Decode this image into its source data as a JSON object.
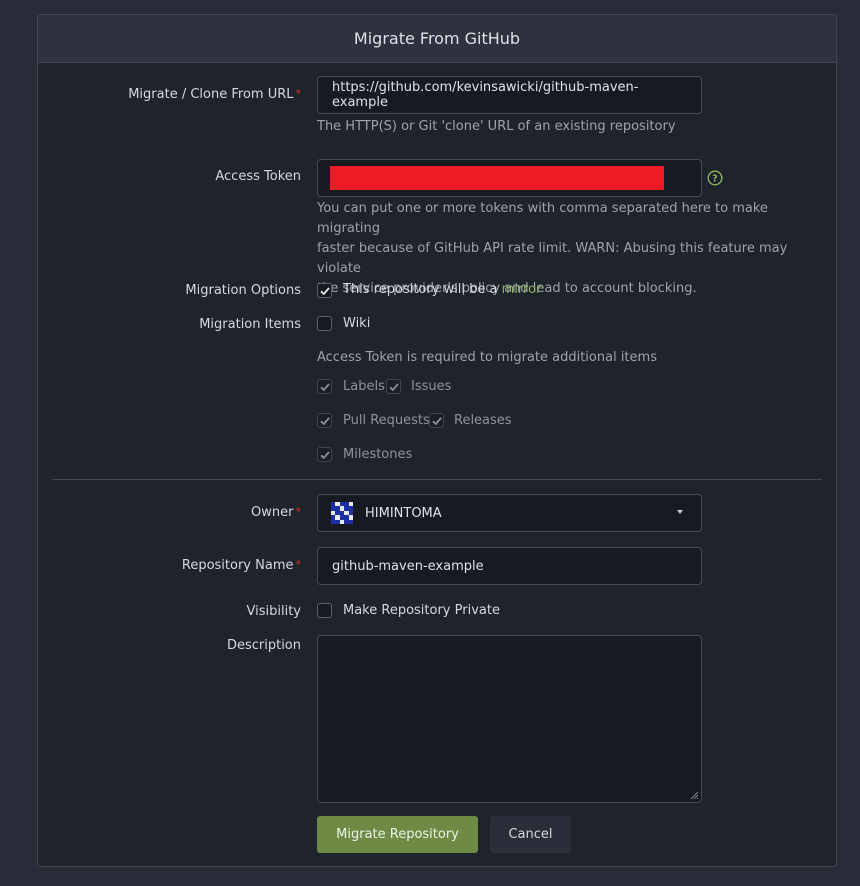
{
  "header": {
    "title": "Migrate From GitHub"
  },
  "clone": {
    "label": "Migrate / Clone From URL",
    "value": "https://github.com/kevinsawicki/github-maven-example",
    "help": "The HTTP(S) or Git 'clone' URL of an existing repository"
  },
  "token": {
    "label": "Access Token",
    "help_line1": "You can put one or more tokens with comma separated here to make migrating",
    "help_line2": "faster because of GitHub API rate limit. WARN: Abusing this feature may violate",
    "help_line3": "the service provider's policy and lead to account blocking.",
    "redaction_color": "#ed1c24"
  },
  "options": {
    "label": "Migration Options",
    "mirror_prefix": "This repository will be a ",
    "mirror_word": "mirror",
    "mirror_checked": true
  },
  "items": {
    "label": "Migration Items",
    "wiki": "Wiki",
    "note": "Access Token is required to migrate additional items",
    "labels": "Labels",
    "issues": "Issues",
    "pull_requests": "Pull Requests",
    "releases": "Releases",
    "milestones": "Milestones"
  },
  "owner": {
    "label": "Owner",
    "value": "HIMINTOMA"
  },
  "repo": {
    "label": "Repository Name",
    "value": "github-maven-example"
  },
  "visibility": {
    "label": "Visibility",
    "checkbox": "Make Repository Private"
  },
  "description": {
    "label": "Description",
    "value": ""
  },
  "buttons": {
    "migrate": "Migrate Repository",
    "cancel": "Cancel"
  },
  "colors": {
    "accent_green": "#6e8a45",
    "required": "#db2828",
    "link_green": "#8fb35f"
  }
}
